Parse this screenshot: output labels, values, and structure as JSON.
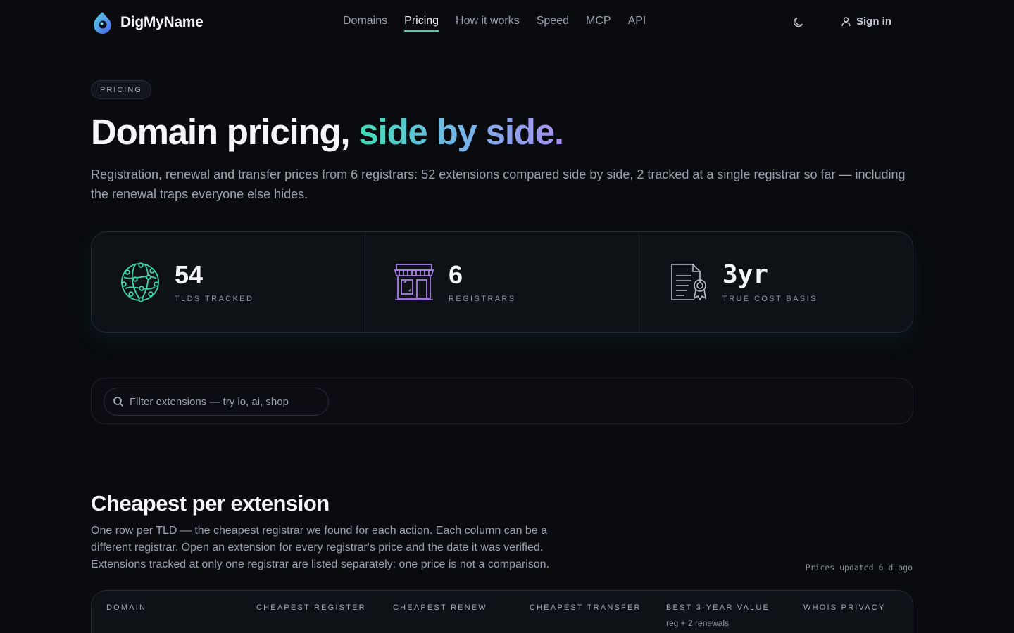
{
  "brand": {
    "name": "DigMyName",
    "accent": "#3fd6b5"
  },
  "nav": {
    "links": [
      "Domains",
      "Pricing",
      "How it works",
      "Speed",
      "MCP",
      "API"
    ],
    "active": "Pricing",
    "theme_icon": "moon-icon",
    "signin_label": "Sign in"
  },
  "hero": {
    "badge": "PRICING",
    "title_plain": "Domain pricing, ",
    "title_gradient": "side by side.",
    "subtitle": "Registration, renewal and transfer prices from 6 registrars: 52 extensions compared side by side, 2 tracked at a single registrar so far — including the renewal traps everyone else hides."
  },
  "stats": [
    {
      "icon": "globe-network-icon",
      "value": "54",
      "label": "TLDS TRACKED"
    },
    {
      "icon": "storefront-icon",
      "value": "6",
      "label": "REGISTRARS"
    },
    {
      "icon": "certificate-icon",
      "value": "3yr",
      "label": "TRUE COST BASIS"
    }
  ],
  "filter": {
    "placeholder": "Filter extensions — try io, ai, shop"
  },
  "section": {
    "title": "Cheapest per extension",
    "description": "One row per TLD — the cheapest registrar we found for each action. Each column can be a different registrar. Open an extension for every registrar's price and the date it was verified. Extensions tracked at only one registrar are listed separately: one price is not a comparison.",
    "updated": "Prices updated 6 d ago"
  },
  "table": {
    "columns": [
      {
        "label": "DOMAIN",
        "sub": ""
      },
      {
        "label": "CHEAPEST REGISTER",
        "sub": ""
      },
      {
        "label": "CHEAPEST RENEW",
        "sub": ""
      },
      {
        "label": "CHEAPEST TRANSFER",
        "sub": ""
      },
      {
        "label": "BEST 3-YEAR VALUE",
        "sub": "reg + 2 renewals"
      },
      {
        "label": "WHOIS PRIVACY",
        "sub": ""
      }
    ]
  }
}
